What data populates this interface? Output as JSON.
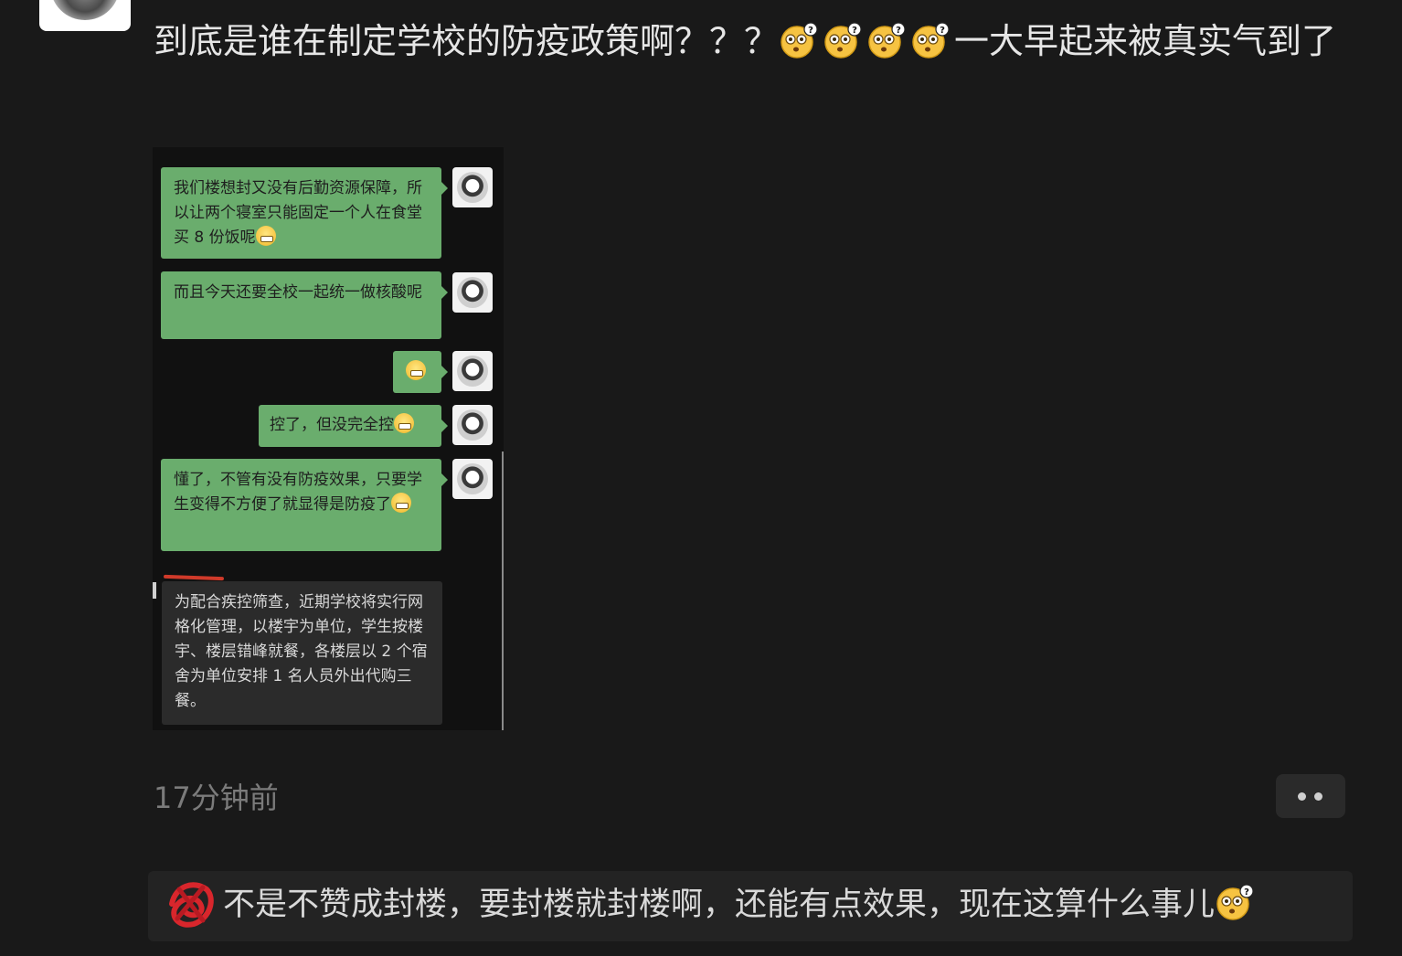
{
  "post": {
    "text_part1": "到底是谁在制定学校的防疫政策啊？？？",
    "emoji_name": "dizzy-question-emoji",
    "text_part2": "一大早起来被真实气到了"
  },
  "screenshot": {
    "messages": [
      {
        "side": "right",
        "text": "我们楼想封又没有后勤资源保障，所以让两个寝室只能固定一个人在食堂买 8 份饭呢",
        "emoji": true
      },
      {
        "side": "right",
        "text": "而且今天还要全校一起统一做核酸呢",
        "emoji": false
      },
      {
        "side": "right",
        "text": "",
        "emoji": true
      },
      {
        "side": "right",
        "text": "控了，但没完全控",
        "emoji": true
      },
      {
        "side": "right",
        "text": "懂了，不管有没有防疫效果，只要学生变得不方便了就显得是防疫了",
        "emoji": true
      },
      {
        "side": "left",
        "text": "为配合疾控筛查，近期学校将实行网格化管理，以楼宇为单位，学生按楼宇、楼层错峰就餐，各楼层以 2 个宿舍为单位安排 1 名人员外出代购三餐。",
        "emoji": false
      }
    ]
  },
  "meta": {
    "time": "17分钟前"
  },
  "comment": {
    "text": "不是不赞成封楼，要封楼就封楼啊，还能有点效果，现在这算什么事儿",
    "emoji_name": "dizzy-question-emoji"
  },
  "colors": {
    "background": "#191919",
    "bubble_green": "#6aad6d",
    "text_light": "#e6e6e6",
    "time_gray": "#7b7b7b"
  }
}
